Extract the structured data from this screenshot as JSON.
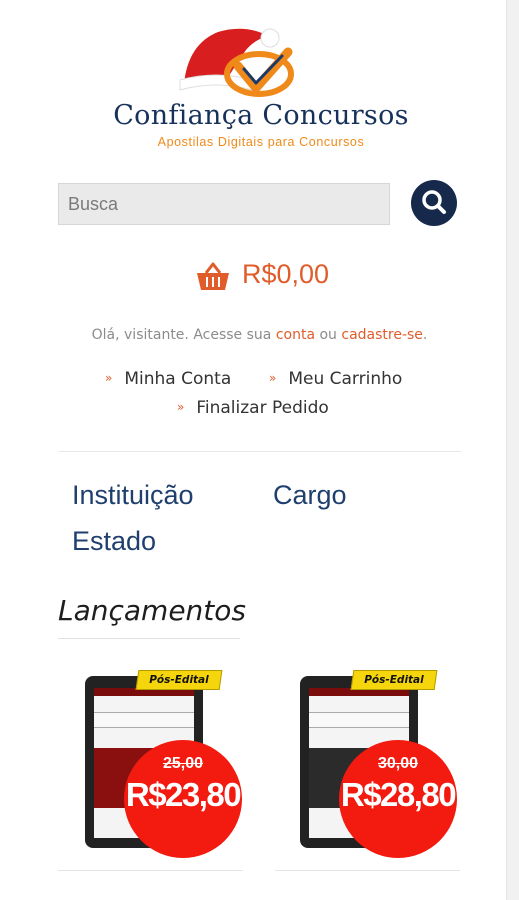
{
  "brand": {
    "name": "Confiança Concursos",
    "tagline": "Apostilas Digitais para Concursos",
    "colors": {
      "navy": "#17325a",
      "orange": "#ef8a1a",
      "accent": "#e05d2b",
      "red": "#f31a10"
    }
  },
  "search": {
    "placeholder": "Busca",
    "button_icon": "search-icon"
  },
  "cart": {
    "icon": "basket-icon",
    "total": "R$0,00"
  },
  "welcome": {
    "prefix": "Olá, visitante. Acesse sua ",
    "account_link": "conta",
    "middle": " ou ",
    "register_link": "cadastre-se",
    "suffix": "."
  },
  "menu": {
    "links": [
      "Minha Conta",
      "Meu Carrinho",
      "Finalizar Pedido"
    ],
    "arrow": "»"
  },
  "filters": [
    "Instituição",
    "Cargo",
    "Estado"
  ],
  "section": {
    "title": "Lançamentos"
  },
  "products": [
    {
      "badge": "Pós-Edital",
      "old_price": "25,00",
      "new_price": "R$23,80"
    },
    {
      "badge": "Pós-Edital",
      "old_price": "30,00",
      "new_price": "R$28,80"
    }
  ]
}
